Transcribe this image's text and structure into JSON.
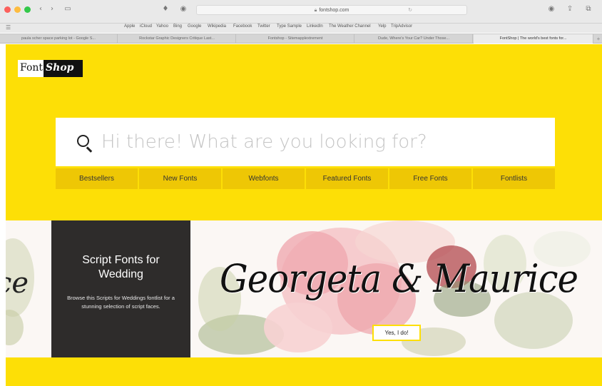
{
  "browser": {
    "url": "fontshop.com",
    "bookmarks": [
      "Apple",
      "iCloud",
      "Yahoo",
      "Bing",
      "Google",
      "Wikipedia",
      "Facebook",
      "Twitter",
      "Type Sample",
      "LinkedIn",
      "The Weather Channel",
      "Yelp",
      "TripAdvisor"
    ],
    "tabs": [
      "paula scher space parking lot - Google S...",
      "Rockstar Graphic Designers Critique Last...",
      "Fontshop - Sitemapplextrement",
      "Dude, Where's Your Car? Under Those...",
      "FontShop | The world's best fonts for..."
    ],
    "active_tab_index": 4
  },
  "logo": {
    "part1": "Font",
    "part2": "Shop"
  },
  "search": {
    "placeholder": "Hi there! What are you looking for?",
    "value": ""
  },
  "nav": [
    "Bestsellers",
    "New Fonts",
    "Webfonts",
    "Featured Fonts",
    "Free Fonts",
    "Fontlists"
  ],
  "banner": {
    "title": "Script Fonts for Wedding",
    "description": "Browse this Scripts for Weddings fontlist for a stunning selection of script faces.",
    "script_text": "Georgeta & Maurice",
    "script_fragment_left": "ce",
    "cta": "Yes, I do!"
  },
  "colors": {
    "brand_yellow": "#fddf06",
    "nav_yellow": "#eec705",
    "card_dark": "#2e2c2b"
  }
}
